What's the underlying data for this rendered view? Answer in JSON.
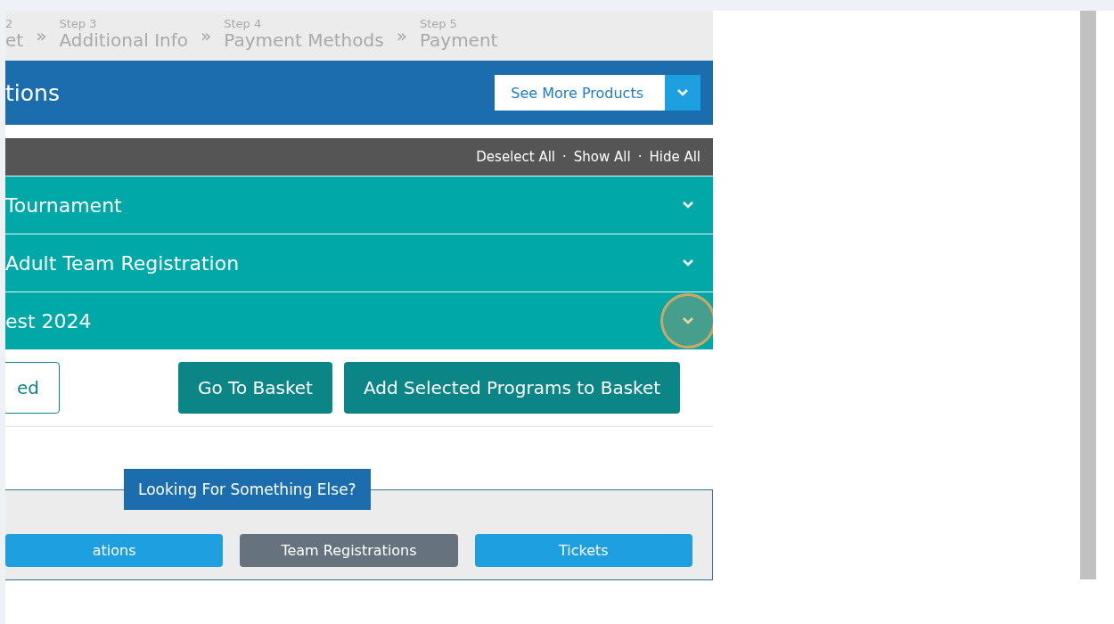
{
  "steps": [
    {
      "number": "2",
      "label": "et"
    },
    {
      "number": "Step 3",
      "label": "Additional Info"
    },
    {
      "number": "Step 4",
      "label": "Payment Methods"
    },
    {
      "number": "Step 5",
      "label": "Payment"
    }
  ],
  "step_separator": "»",
  "header": {
    "title": "tions",
    "dropdown": "See More Products"
  },
  "toolbar": {
    "links": [
      "Deselect All",
      "Show All",
      "Hide All"
    ],
    "separator": "·"
  },
  "accordion": [
    {
      "title": "Tournament",
      "expanded": false,
      "highlighted": false
    },
    {
      "title": "Adult Team Registration",
      "expanded": false,
      "highlighted": false
    },
    {
      "title": "est 2024",
      "expanded": false,
      "highlighted": true
    }
  ],
  "actions": [
    {
      "label": "ed",
      "kind": "outline"
    },
    {
      "label": "Go To Basket",
      "kind": "solid"
    },
    {
      "label": "Add Selected Programs to Basket",
      "kind": "solid"
    }
  ],
  "more": {
    "legend": "Looking For Something Else?",
    "buttons": [
      {
        "label": "ations",
        "selected": false
      },
      {
        "label": "Team Registrations",
        "selected": true
      },
      {
        "label": "Tickets",
        "selected": false
      }
    ]
  }
}
